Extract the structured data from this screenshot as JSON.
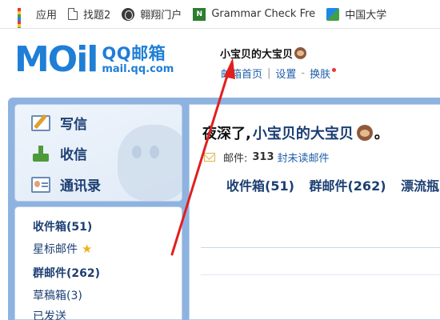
{
  "bookmarks": [
    {
      "label": "应用",
      "icon": "apps-grid-icon"
    },
    {
      "label": "找题2",
      "icon": "page-icon"
    },
    {
      "label": "翱翔门户",
      "icon": "globe-icon"
    },
    {
      "label": "Grammar Check Fre",
      "icon": "grammar-check-icon"
    },
    {
      "label": "中国大学",
      "icon": "map-icon"
    }
  ],
  "header": {
    "logo_text": "MOil",
    "logo_title": "QQ邮箱",
    "logo_url": "mail.qq.com",
    "user_name": "小宝贝的大宝贝",
    "links": [
      "邮箱首页",
      "设置",
      "换肤"
    ]
  },
  "sidebar": {
    "nav": [
      {
        "label": "写信",
        "icon": "write-pencil-icon"
      },
      {
        "label": "收信",
        "icon": "inbox-download-icon"
      },
      {
        "label": "通讯录",
        "icon": "contacts-card-icon"
      }
    ],
    "folders": [
      {
        "label": "收件箱(51)",
        "bold": true
      },
      {
        "label": "星标邮件",
        "bold": false,
        "star": true
      },
      {
        "label": "群邮件(262)",
        "bold": true
      },
      {
        "label": "草稿箱(3)",
        "bold": false
      },
      {
        "label": "已发送",
        "bold": false
      }
    ]
  },
  "main": {
    "greeting_prefix": "夜深了,",
    "greeting_name": "小宝贝的大宝贝",
    "greeting_suffix": "。",
    "mail_label": "邮件:",
    "unread_count": "313",
    "unread_suffix": "封未读邮件",
    "quick_links": [
      "收件箱(51)",
      "群邮件(262)",
      "漂流瓶"
    ]
  },
  "colors": {
    "brand_blue": "#1f7ed6",
    "nav_text": "#1c3f73",
    "frame": "#8fb3e0",
    "annotation_arrow": "#e02020"
  }
}
